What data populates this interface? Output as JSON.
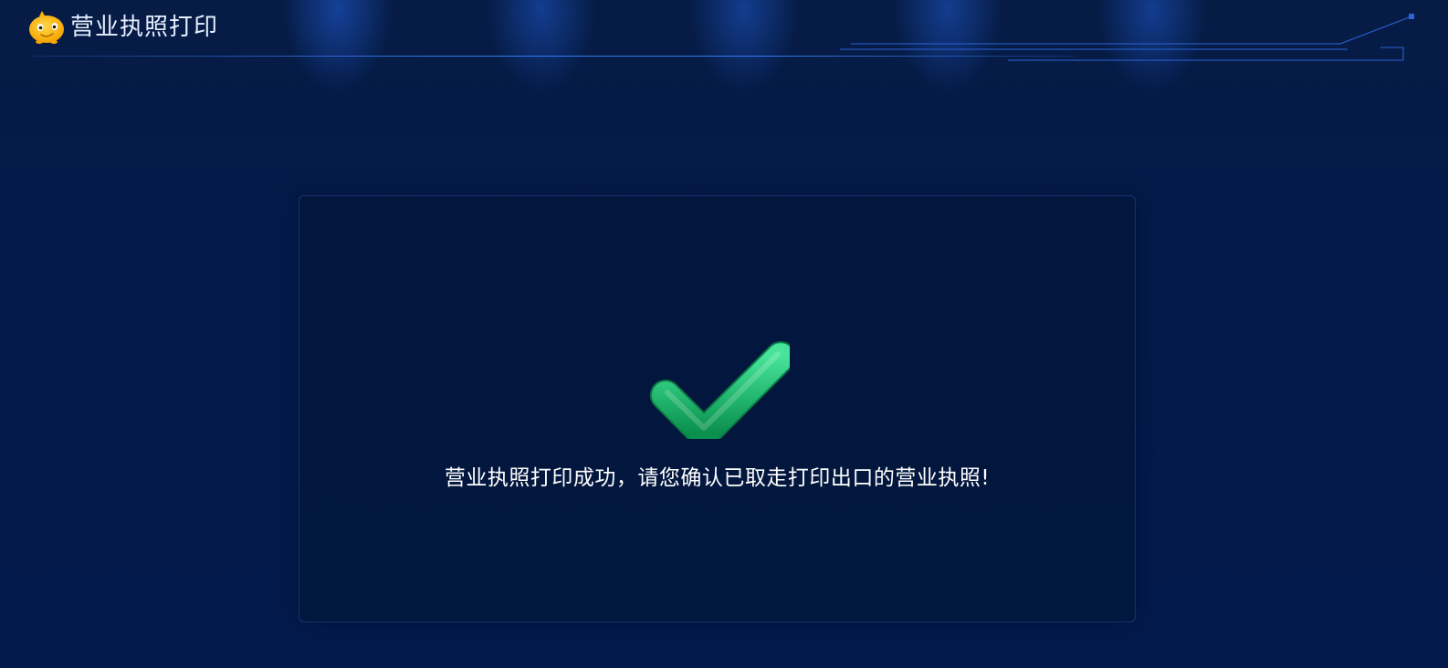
{
  "header": {
    "title": "营业执照打印",
    "logo_icon": "mascot-logo-icon"
  },
  "result": {
    "status_icon": "success-checkmark-icon",
    "message": "营业执照打印成功，请您确认已取走打印出口的营业执照!"
  },
  "colors": {
    "background": "#041a49",
    "panel": "#03163d",
    "accent": "#3a8bff",
    "success": "#1fb36b",
    "text": "#ffffff"
  }
}
